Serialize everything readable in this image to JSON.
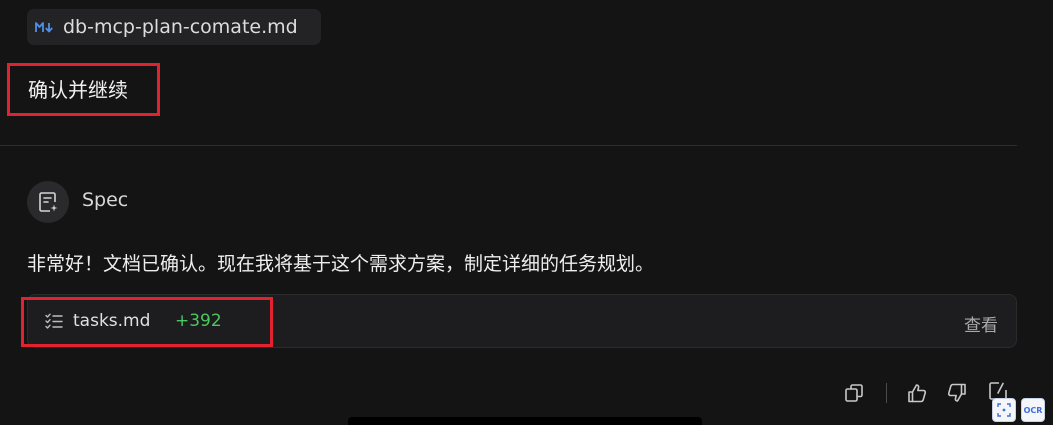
{
  "attachment": {
    "file_name": "db-mcp-plan-comate.md",
    "icon": "markdown-icon"
  },
  "user_message": {
    "text": "确认并继续"
  },
  "agent": {
    "name": "Spec",
    "icon": "spec-document-icon"
  },
  "response": {
    "text": "非常好！文档已确认。现在我将基于这个需求方案，制定详细的任务规划。"
  },
  "task_file": {
    "icon": "task-list-icon",
    "name": "tasks.md",
    "additions": "+392",
    "view_label": "查看"
  },
  "toolbar": {
    "icons": [
      "copy-icon",
      "thumbs-up-icon",
      "thumbs-down-icon",
      "edit-icon"
    ]
  },
  "corner_buttons": {
    "right_label": "OCR"
  },
  "colors": {
    "accent_green": "#4cc760",
    "highlight_red": "#e0232e",
    "background": "#141415"
  }
}
